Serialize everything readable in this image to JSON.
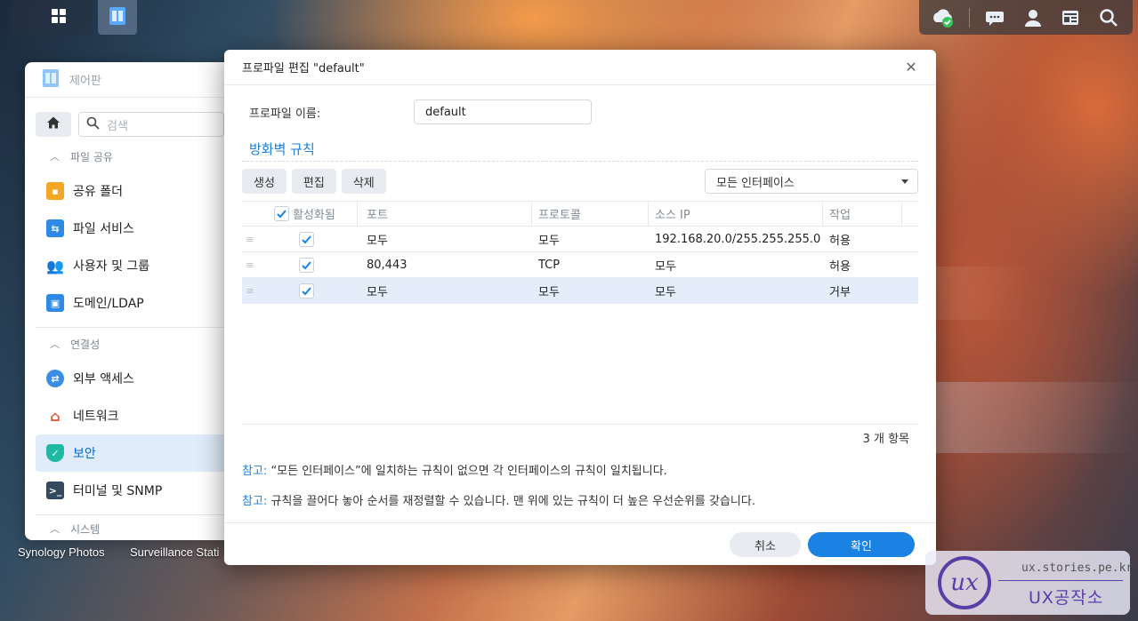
{
  "taskbar": {
    "right_icons": [
      "cloud-check-icon",
      "chat-icon",
      "user-icon",
      "widget-icon",
      "search-icon"
    ]
  },
  "control_panel": {
    "title": "제어판",
    "search_placeholder": "검색",
    "sections": [
      {
        "label": "파일 공유",
        "items": [
          "공유 폴더",
          "파일 서비스",
          "사용자 및 그룹",
          "도메인/LDAP"
        ]
      },
      {
        "label": "연결성",
        "items": [
          "외부 액세스",
          "네트워크",
          "보안",
          "터미널 및 SNMP"
        ]
      },
      {
        "label": "시스템",
        "items": []
      }
    ],
    "active_item": "보안"
  },
  "desktop": {
    "labels": [
      "Synology Photos",
      "Surveillance Stati"
    ]
  },
  "dialog": {
    "title": "프로파일 편집 \"default\"",
    "close_label": "✕",
    "profile_name_label": "프로파일 이름:",
    "profile_name_value": "default",
    "firewall_rules_title": "방화벽 규칙",
    "toolbar": {
      "create": "생성",
      "edit": "편집",
      "delete": "삭제"
    },
    "interface_select": "모든 인터페이스",
    "columns": {
      "enabled": "활성화됨",
      "port": "포트",
      "protocol": "프로토콜",
      "source_ip": "소스 IP",
      "action": "작업"
    },
    "rows": [
      {
        "enabled": true,
        "port": "모두",
        "protocol": "모두",
        "source_ip": "192.168.20.0/255.255.255.0",
        "action": "허용"
      },
      {
        "enabled": true,
        "port": "80,443",
        "protocol": "TCP",
        "source_ip": "모두",
        "action": "허용"
      },
      {
        "enabled": true,
        "port": "모두",
        "protocol": "모두",
        "source_ip": "모두",
        "action": "거부"
      }
    ],
    "item_count": "3 개 항목",
    "note1_tag": "참고:",
    "note1_text": " “모든 인터페이스”에 일치하는 규칙이 없으면 각 인터페이스의 규칙이 일치됩니다.",
    "note2_tag": "참고:",
    "note2_text": " 규칙을 끌어다 놓아 순서를 재정렬할 수 있습니다. 맨 위에 있는 규칙이 더 높은 우선순위를 갖습니다.",
    "cancel_label": "취소",
    "ok_label": "확인"
  },
  "watermark": {
    "logo_text": "ux",
    "url": "ux.stories.pe.kr",
    "name": "UX공작소"
  },
  "colors": {
    "accent": "#1a82e2",
    "link": "#1c7fd6",
    "selected_row": "#e3eefa"
  }
}
